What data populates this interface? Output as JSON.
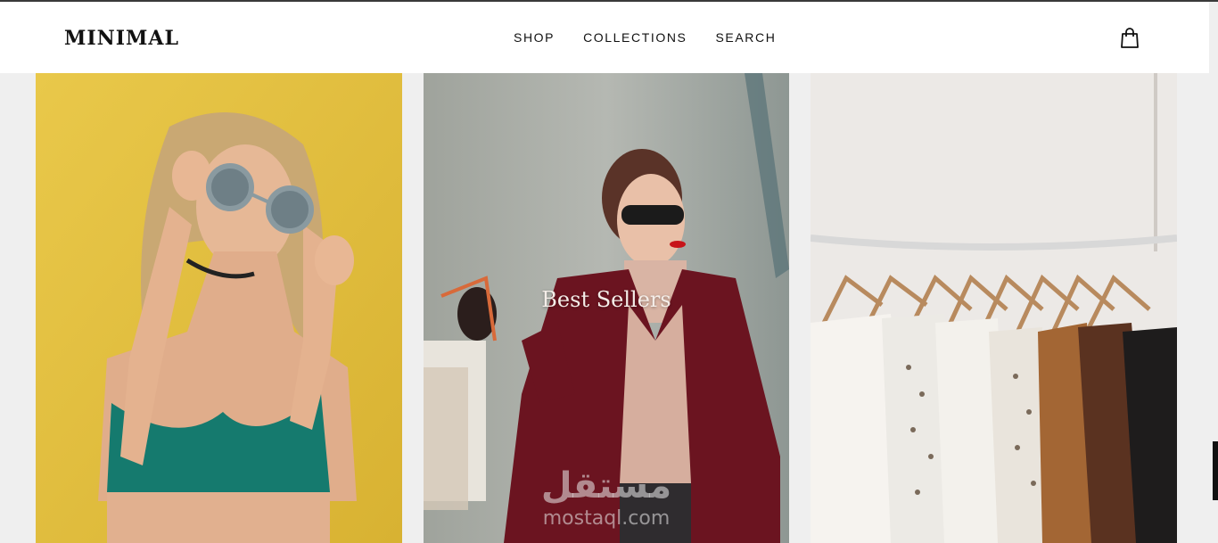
{
  "header": {
    "logo": "MINIMAL",
    "nav": [
      {
        "label": "SHOP"
      },
      {
        "label": "COLLECTIONS"
      },
      {
        "label": "SEARCH"
      }
    ],
    "cart_icon": "shopping-bag-icon"
  },
  "cards": [
    {
      "image": "woman-round-sunglasses-photo",
      "title": ""
    },
    {
      "image": "woman-red-coat-shopping-photo",
      "title": "Best Sellers"
    },
    {
      "image": "clothes-rack-photo",
      "title": ""
    }
  ],
  "watermark": {
    "arabic": "مستقل",
    "latin": "mostaql.com"
  },
  "colors": {
    "background": "#efefef",
    "header": "#ffffff",
    "text": "#111111"
  }
}
